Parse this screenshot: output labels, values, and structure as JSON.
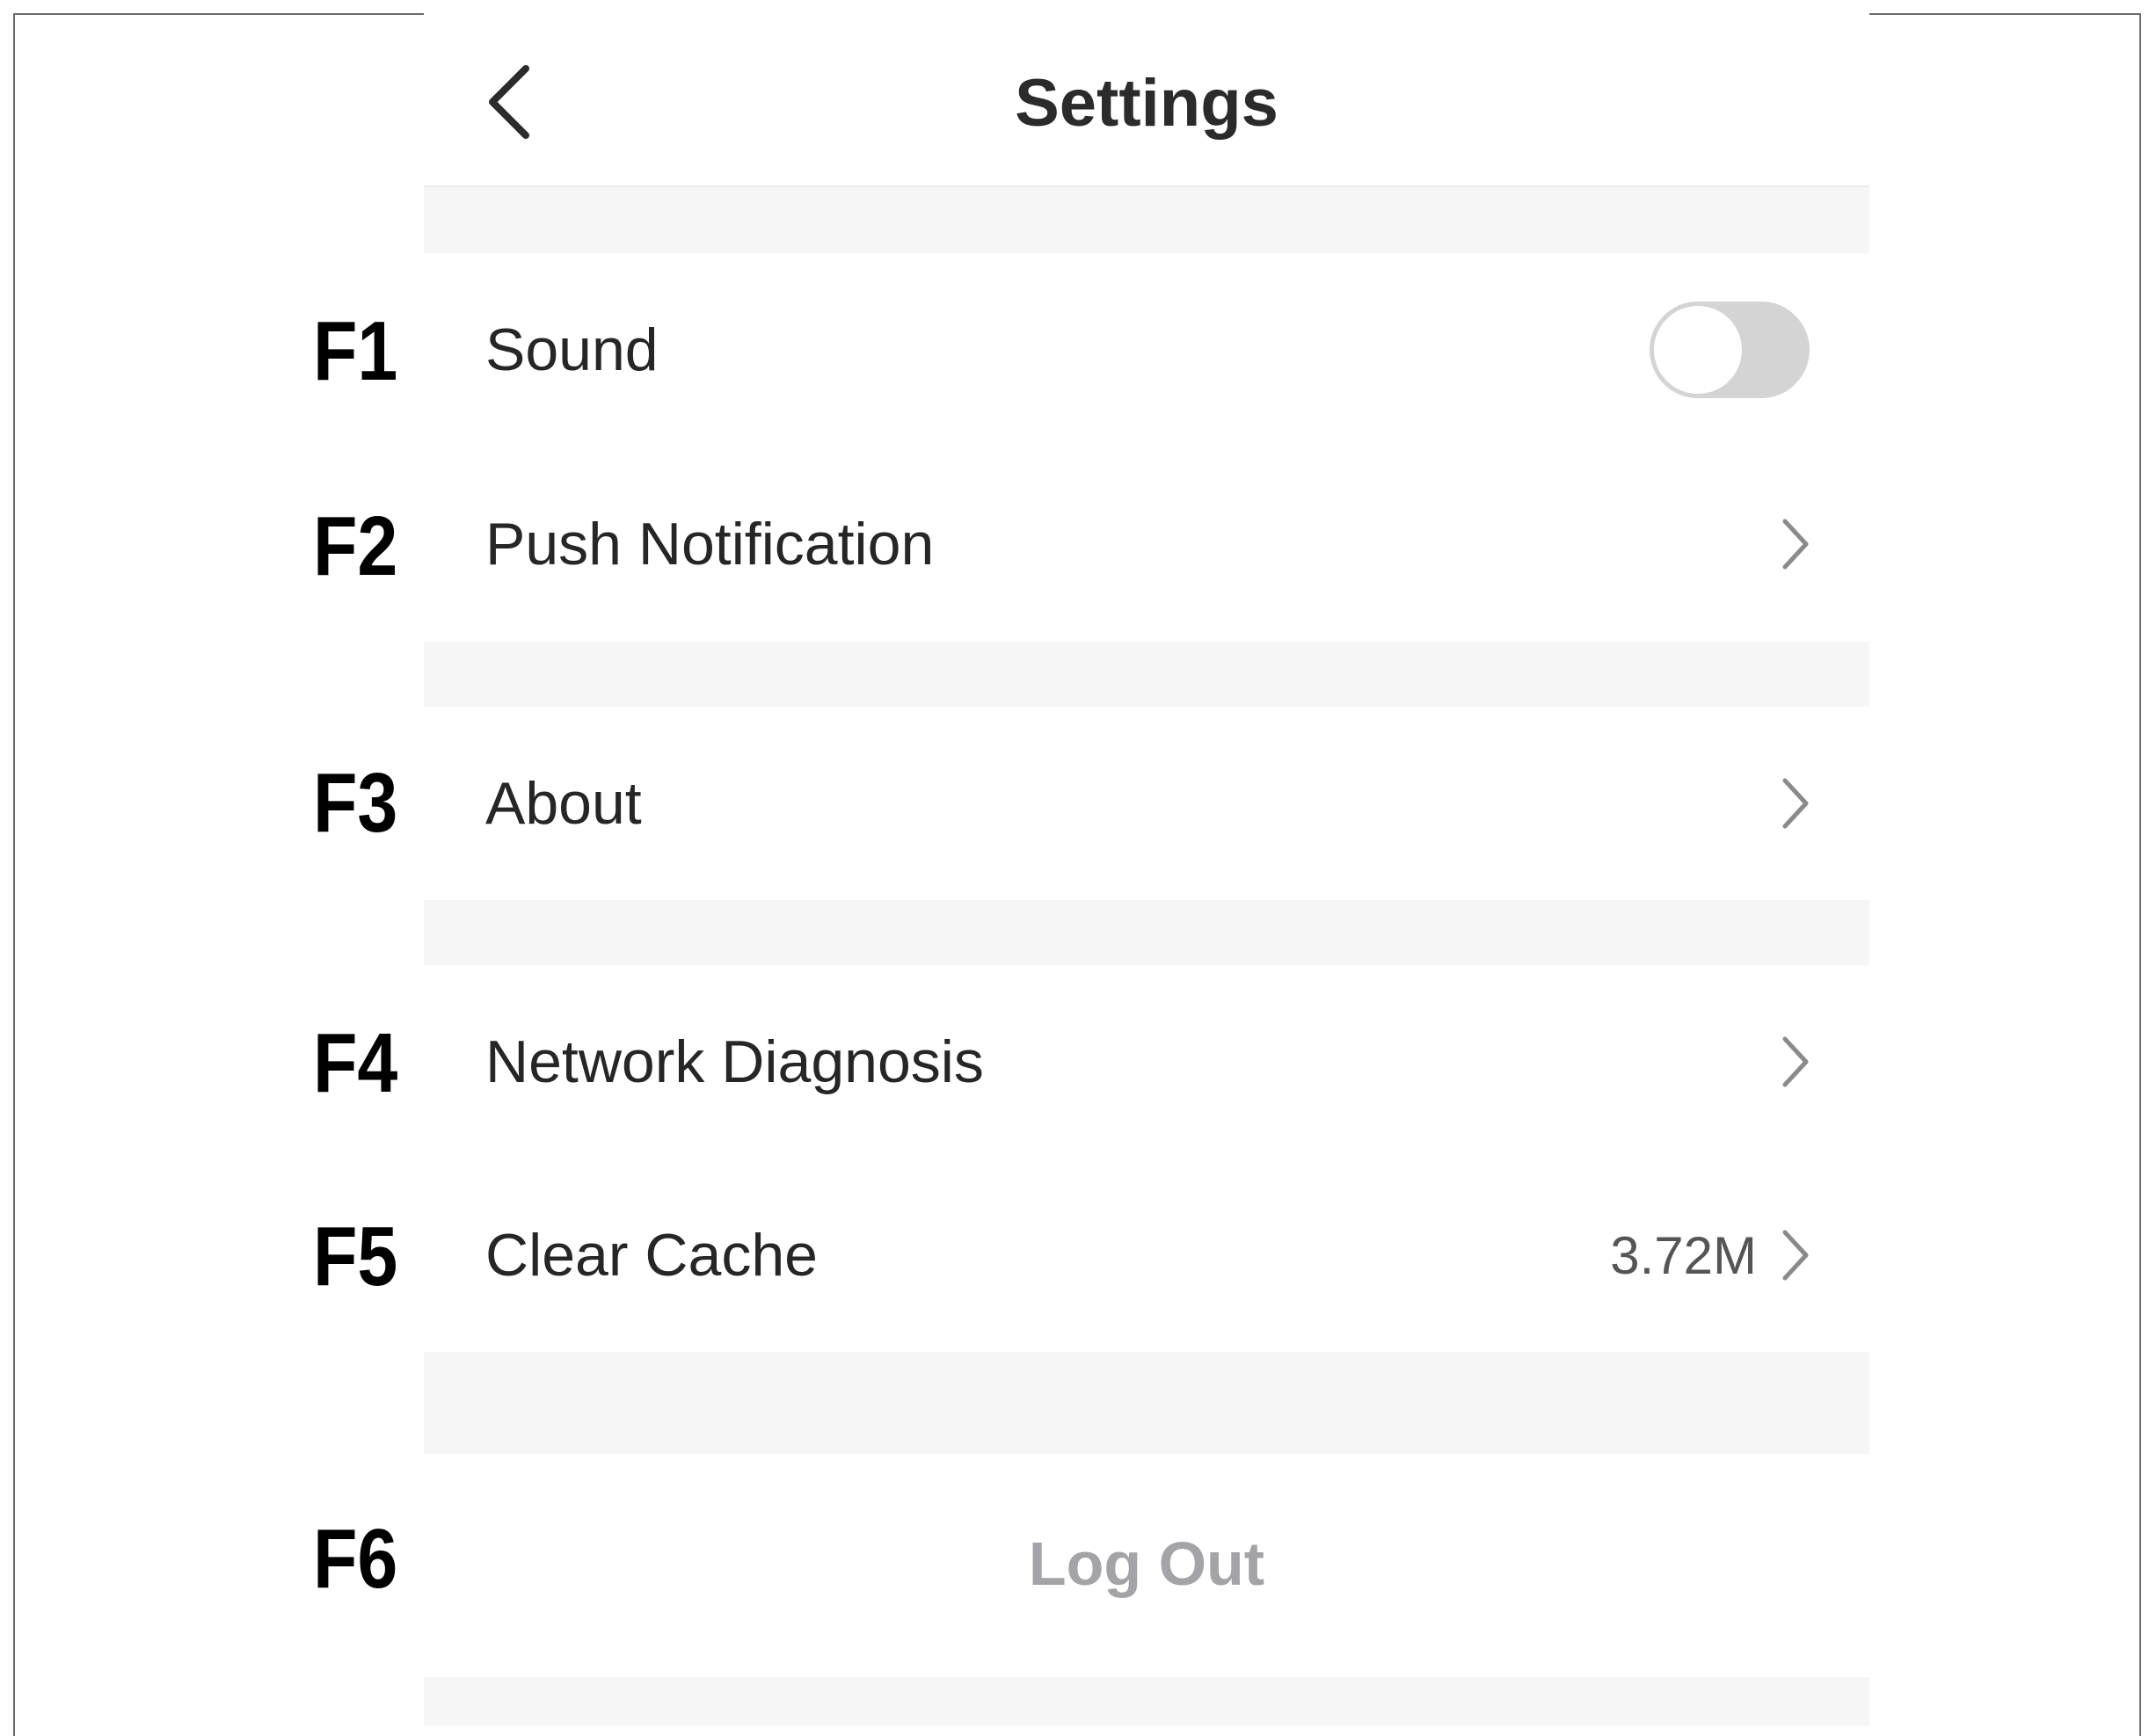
{
  "header": {
    "title": "Settings",
    "back_icon": "chevron-left-icon"
  },
  "annotations": [
    "F1",
    "F2",
    "F3",
    "F4",
    "F5",
    "F6"
  ],
  "settings": {
    "sound": {
      "label": "Sound",
      "toggle_on": false
    },
    "push_notification": {
      "label": "Push Notification"
    },
    "about": {
      "label": "About"
    },
    "network_diagnosis": {
      "label": "Network Diagnosis"
    },
    "clear_cache": {
      "label": "Clear Cache",
      "value": "3.72M"
    }
  },
  "logout": {
    "label": "Log Out"
  },
  "colors": {
    "title_text": "#2b2b2b",
    "row_text": "#262626",
    "section_gap": "#f6f6f6",
    "toggle_off": "#d4d4d4",
    "logout_text": "#a3a3a8"
  }
}
